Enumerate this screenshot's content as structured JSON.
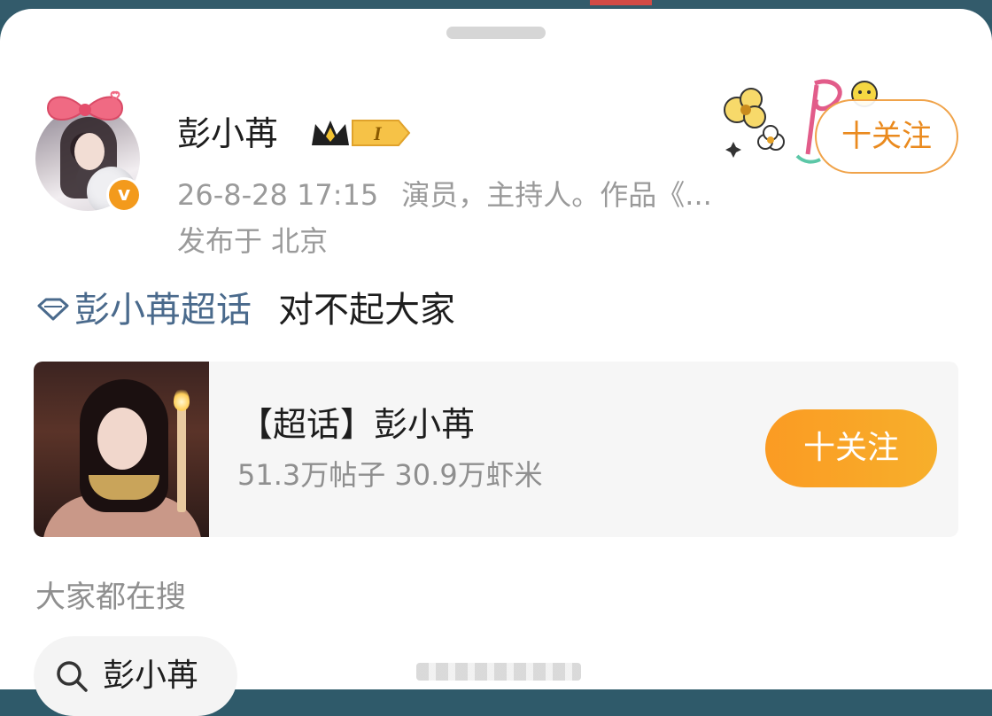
{
  "post": {
    "author": {
      "name": "彭小苒",
      "level_label": "I",
      "verified_mark": "v",
      "time": "26-8-28 17:15",
      "bio": "演员，主持人。作品《...",
      "location": "发布于 北京"
    },
    "follow_label": "十关注",
    "supertopic_link": "彭小苒超话",
    "text": "对不起大家"
  },
  "card": {
    "title": "【超话】彭小苒",
    "stats": "51.3万帖子 30.9万虾米",
    "follow_label": "十关注"
  },
  "trending": {
    "section_title": "大家都在搜",
    "chip_label": "彭小苒"
  },
  "colors": {
    "accent_orange": "#f7a326",
    "link_blue": "#4a6a8c",
    "muted_gray": "#9a9a9a"
  },
  "icons": [
    "bow-icon",
    "verified-icon",
    "crown-icon",
    "level-badge-icon",
    "diamond-icon",
    "search-icon"
  ]
}
